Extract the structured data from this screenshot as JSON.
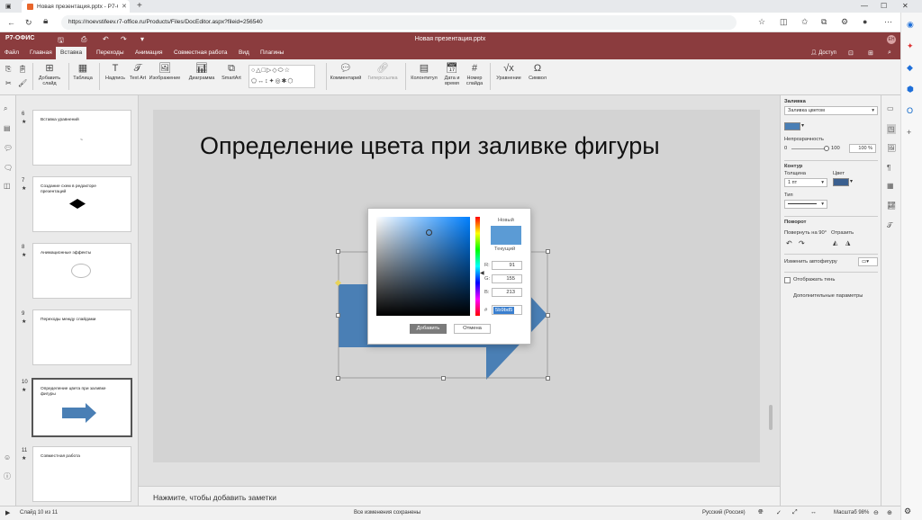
{
  "browser": {
    "tab_title": "Новая презентация.pptx - Р7-О",
    "new_tab": "+",
    "url": "https://noevstifeev.r7-office.ru/Products/Files/DocEditor.aspx?fileid=256540"
  },
  "app": {
    "logo": "Р7-ОФИС",
    "doc_title": "Новая презентация.pptx",
    "avatar": "ЕН",
    "access_label": "Доступ"
  },
  "menu": {
    "tabs": [
      "Файл",
      "Главная",
      "Вставка",
      "Переходы",
      "Анимация",
      "Совместная работа",
      "Вид",
      "Плагины"
    ],
    "active_tab": "Вставка"
  },
  "toolbar": {
    "add_slide": "Добавить слайд",
    "table": "Таблица",
    "textbox": "Надпись",
    "textart": "Text Art",
    "image": "Изображение",
    "chart": "Диаграмма",
    "smartart": "SmartArt",
    "comment": "Комментарий",
    "hyperlink": "Гиперссылка",
    "header_footer": "Колонтитул",
    "datetime": "Дата и время",
    "slide_number": "Номер слайда",
    "equation": "Уравнение",
    "symbol": "Символ"
  },
  "slides": [
    {
      "number": "6",
      "title": "Вставка уравнений"
    },
    {
      "number": "7",
      "title": "Создание схем в редакторе презентаций"
    },
    {
      "number": "8",
      "title": "Анимационные эффекты"
    },
    {
      "number": "9",
      "title": "Переходы между слайдами"
    },
    {
      "number": "10",
      "title": "Определение цвета при заливке фигуры"
    },
    {
      "number": "11",
      "title": "Совместная работа"
    }
  ],
  "selected_slide": "10",
  "slide": {
    "title": "Определение цвета при заливке фигуры",
    "shape_color": "#4a7fb5"
  },
  "notes_placeholder": "Нажмите, чтобы добавить заметки",
  "color_dialog": {
    "new_label": "Новый",
    "current_label": "Текущий",
    "r_label": "R:",
    "g_label": "G:",
    "b_label": "B:",
    "hex_label": "#",
    "r": "91",
    "g": "155",
    "b": "213",
    "hex": "5b9bd5",
    "new_color": "#5b9bd5",
    "add_button": "Добавить",
    "cancel_button": "Отмена"
  },
  "right_panel": {
    "fill_label": "Заливка",
    "fill_type": "Заливка цветом",
    "opacity_label": "Непрозрачность",
    "opacity_min": "0",
    "opacity_max": "100",
    "opacity_value": "100 %",
    "stroke_label": "Контур",
    "width_label": "Толщина",
    "color_label": "Цвет",
    "width_value": "1 пт",
    "type_label": "Тип",
    "rotation_label": "Поворот",
    "rotate90_label": "Повернуть на 90°",
    "flip_label": "Отразить",
    "autoshape_label": "Изменить автофигуру",
    "shadow_label": "Отображать тень",
    "advanced_label": "Дополнительные параметры",
    "fill_color": "#4a7fb5",
    "stroke_color": "#3a5f8f"
  },
  "status": {
    "slide_counter": "Слайд 10 из 11",
    "saved": "Все изменения сохранены",
    "language": "Русский (Россия)",
    "zoom": "Масштаб 98%"
  }
}
